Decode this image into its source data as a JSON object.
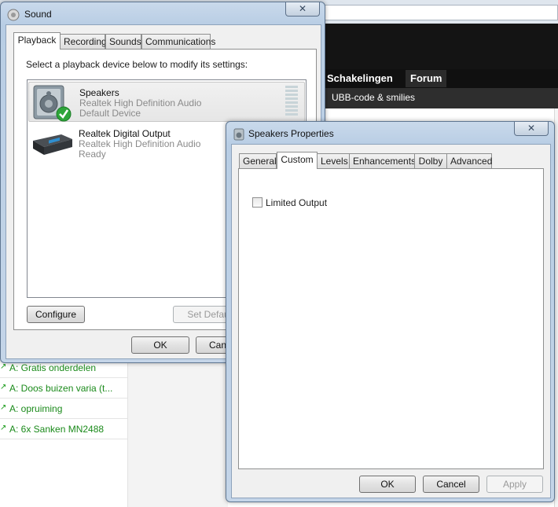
{
  "background": {
    "nav_items": [
      "Schakelingen",
      "Forum"
    ],
    "subnav_item": "UBB-code & smilies",
    "list_items": [
      "A: Gratis onderdelen",
      "A: Doos buizen varia (t...",
      "A: opruiming",
      "A: 6x Sanken MN2488"
    ]
  },
  "sound_dialog": {
    "title": "Sound",
    "close_label": "✕",
    "tabs": [
      "Playback",
      "Recording",
      "Sounds",
      "Communications"
    ],
    "instruction": "Select a playback device below to modify its settings:",
    "devices": [
      {
        "name": "Speakers",
        "driver": "Realtek High Definition Audio",
        "status": "Default Device",
        "icon": "speaker-icon"
      },
      {
        "name": "Realtek Digital Output",
        "driver": "Realtek High Definition Audio",
        "status": "Ready",
        "icon": "digital-output-icon"
      }
    ],
    "buttons": {
      "configure": "Configure",
      "set_default": "Set Default",
      "ok": "OK",
      "cancel": "Canc"
    }
  },
  "properties_dialog": {
    "title": "Speakers Properties",
    "close_label": "✕",
    "tabs": [
      "General",
      "Custom",
      "Levels",
      "Enhancements",
      "Dolby",
      "Advanced"
    ],
    "active_tab": "Custom",
    "limited_output_label": "Limited Output",
    "limited_output_checked": false,
    "buttons": {
      "ok": "OK",
      "cancel": "Cancel",
      "apply": "Apply"
    }
  }
}
